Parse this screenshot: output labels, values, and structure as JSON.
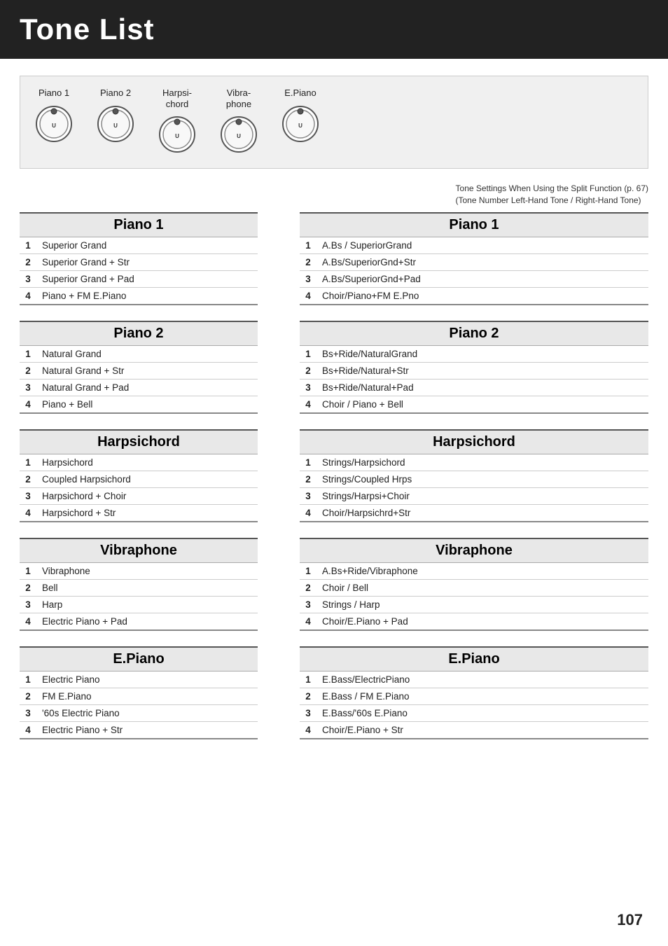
{
  "header": {
    "title": "Tone List"
  },
  "instruments": [
    {
      "label": "Piano 1",
      "id": "piano1"
    },
    {
      "label": "Piano 2",
      "id": "piano2"
    },
    {
      "label": "Harpsi-\nchord",
      "id": "harpsichord"
    },
    {
      "label": "Vibra-\nphone",
      "id": "vibraphone"
    },
    {
      "label": "E.Piano",
      "id": "epiano"
    }
  ],
  "split_note_line1": "Tone Settings When Using the Split Function (p. 67)",
  "split_note_line2": "(Tone Number Left-Hand Tone / Right-Hand Tone)",
  "left_sections": [
    {
      "title": "Piano 1",
      "rows": [
        {
          "num": "1",
          "name": "Superior Grand"
        },
        {
          "num": "2",
          "name": "Superior Grand + Str"
        },
        {
          "num": "3",
          "name": "Superior Grand + Pad"
        },
        {
          "num": "4",
          "name": "Piano + FM E.Piano"
        }
      ]
    },
    {
      "title": "Piano 2",
      "rows": [
        {
          "num": "1",
          "name": "Natural Grand"
        },
        {
          "num": "2",
          "name": "Natural Grand + Str"
        },
        {
          "num": "3",
          "name": "Natural Grand + Pad"
        },
        {
          "num": "4",
          "name": "Piano + Bell"
        }
      ]
    },
    {
      "title": "Harpsichord",
      "rows": [
        {
          "num": "1",
          "name": "Harpsichord"
        },
        {
          "num": "2",
          "name": "Coupled Harpsichord"
        },
        {
          "num": "3",
          "name": "Harpsichord + Choir"
        },
        {
          "num": "4",
          "name": "Harpsichord + Str"
        }
      ]
    },
    {
      "title": "Vibraphone",
      "rows": [
        {
          "num": "1",
          "name": "Vibraphone"
        },
        {
          "num": "2",
          "name": "Bell"
        },
        {
          "num": "3",
          "name": "Harp"
        },
        {
          "num": "4",
          "name": "Electric Piano + Pad"
        }
      ]
    },
    {
      "title": "E.Piano",
      "rows": [
        {
          "num": "1",
          "name": "Electric Piano"
        },
        {
          "num": "2",
          "name": "FM E.Piano"
        },
        {
          "num": "3",
          "name": "'60s Electric Piano"
        },
        {
          "num": "4",
          "name": "Electric Piano + Str"
        }
      ]
    }
  ],
  "right_sections": [
    {
      "title": "Piano 1",
      "rows": [
        {
          "num": "1",
          "name": "A.Bs / SuperiorGrand"
        },
        {
          "num": "2",
          "name": "A.Bs/SuperiorGnd+Str"
        },
        {
          "num": "3",
          "name": "A.Bs/SuperiorGnd+Pad"
        },
        {
          "num": "4",
          "name": "Choir/Piano+FM E.Pno"
        }
      ]
    },
    {
      "title": "Piano 2",
      "rows": [
        {
          "num": "1",
          "name": "Bs+Ride/NaturalGrand"
        },
        {
          "num": "2",
          "name": "Bs+Ride/Natural+Str"
        },
        {
          "num": "3",
          "name": "Bs+Ride/Natural+Pad"
        },
        {
          "num": "4",
          "name": "Choir / Piano + Bell"
        }
      ]
    },
    {
      "title": "Harpsichord",
      "rows": [
        {
          "num": "1",
          "name": "Strings/Harpsichord"
        },
        {
          "num": "2",
          "name": "Strings/Coupled Hrps"
        },
        {
          "num": "3",
          "name": "Strings/Harpsi+Choir"
        },
        {
          "num": "4",
          "name": "Choir/Harpsichrd+Str"
        }
      ]
    },
    {
      "title": "Vibraphone",
      "rows": [
        {
          "num": "1",
          "name": "A.Bs+Ride/Vibraphone"
        },
        {
          "num": "2",
          "name": "Choir / Bell"
        },
        {
          "num": "3",
          "name": "Strings / Harp"
        },
        {
          "num": "4",
          "name": "Choir/E.Piano + Pad"
        }
      ]
    },
    {
      "title": "E.Piano",
      "rows": [
        {
          "num": "1",
          "name": "E.Bass/ElectricPiano"
        },
        {
          "num": "2",
          "name": "E.Bass / FM E.Piano"
        },
        {
          "num": "3",
          "name": "E.Bass/'60s E.Piano"
        },
        {
          "num": "4",
          "name": "Choir/E.Piano + Str"
        }
      ]
    }
  ],
  "page_number": "107"
}
